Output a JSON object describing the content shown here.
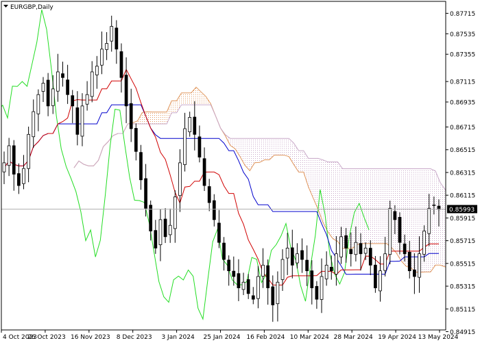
{
  "window": {
    "symbol_label": "EURGBP,Daily",
    "current_price": "0.85993"
  },
  "colors": {
    "candles": "#000000",
    "tenkan": "#d00000",
    "kijun": "#0000cc",
    "chikou": "#22dd22",
    "senkou_a_cloud": "#e0955a",
    "senkou_b_cloud": "#c8a8c8",
    "price_line": "#b0b0b0",
    "price_label_bg": "#000000",
    "price_label_fg": "#ffffff"
  },
  "chart_data": {
    "type": "candlestick",
    "title": "",
    "grid": false,
    "ylim": [
      0.8493,
      0.8782
    ],
    "y_ticks": [
      "0.87715",
      "0.87535",
      "0.87355",
      "0.87115",
      "0.86935",
      "0.86715",
      "0.86515",
      "0.86315",
      "0.86115",
      "0.85915",
      "0.85715",
      "0.85515",
      "0.85315",
      "0.85115",
      "0.84915"
    ],
    "x_ticks": [
      "4 Oct 2023",
      "26 Oct 2023",
      "16 Nov 2023",
      "8 Dec 2023",
      "3 Jan 2024",
      "25 Jan 2024",
      "16 Feb 2024",
      "10 Mar 2024",
      "28 Mar 2024",
      "19 Apr 2024",
      "13 May 2024"
    ],
    "series": [
      {
        "name": "",
        "kind": "close_approx",
        "values": [
          0.864,
          0.8655,
          0.863,
          0.862,
          0.8635,
          0.8665,
          0.8685,
          0.87,
          0.871,
          0.869,
          0.8705,
          0.872,
          0.8715,
          0.87,
          0.869,
          0.8665,
          0.869,
          0.87,
          0.872,
          0.8725,
          0.874,
          0.8745,
          0.876,
          0.874,
          0.8715,
          0.869,
          0.867,
          0.865,
          0.8625,
          0.86,
          0.858,
          0.8565,
          0.859,
          0.8575,
          0.8585,
          0.861,
          0.864,
          0.867,
          0.868,
          0.8665,
          0.8645,
          0.862,
          0.8605,
          0.859,
          0.857,
          0.8555,
          0.8545,
          0.854,
          0.853,
          0.8535,
          0.8525,
          0.852,
          0.854,
          0.855,
          0.853,
          0.8515,
          0.8535,
          0.8555,
          0.8565,
          0.855,
          0.856,
          0.8555,
          0.8545,
          0.853,
          0.852,
          0.854,
          0.855,
          0.8545,
          0.856,
          0.8575,
          0.8565,
          0.856,
          0.857,
          0.856,
          0.8565,
          0.855,
          0.853,
          0.8545,
          0.856,
          0.86,
          0.859,
          0.857,
          0.856,
          0.8545,
          0.854,
          0.856,
          0.858,
          0.86,
          0.8603,
          0.8599
        ]
      }
    ]
  }
}
